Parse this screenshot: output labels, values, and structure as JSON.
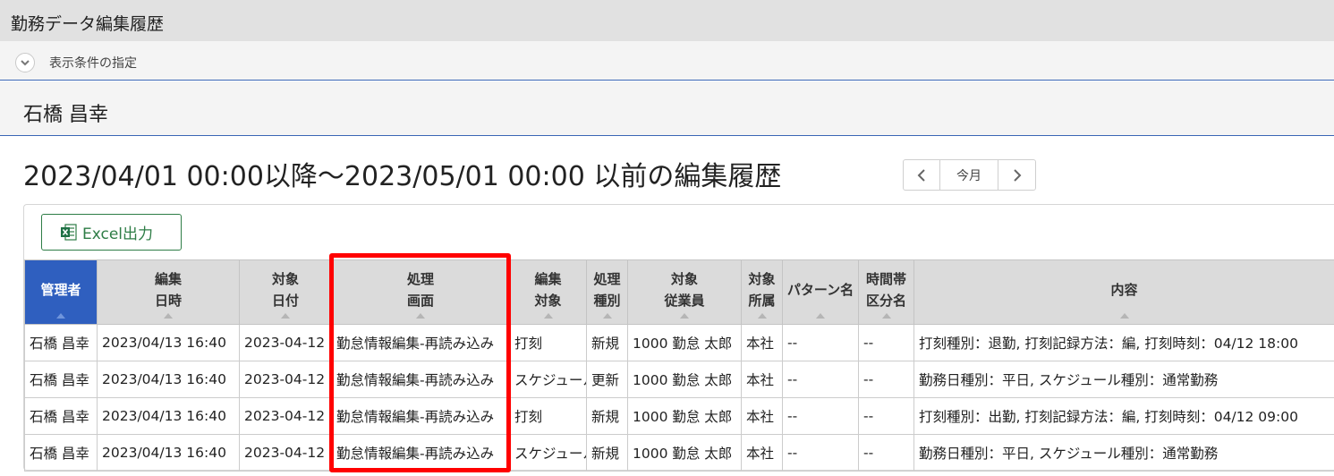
{
  "page": {
    "title": "勤務データ編集履歴",
    "condition_label": "表示条件の指定",
    "employee_name": "石橋 昌幸",
    "heading": "2023/04/01 00:00以降～2023/05/01 00:00 以前の編集履歴",
    "pager": {
      "prev": "‹",
      "current": "今月",
      "next": "›"
    },
    "excel_button": "Excel出力"
  },
  "table": {
    "headers": [
      {
        "l1": "管理者",
        "l2": ""
      },
      {
        "l1": "編集",
        "l2": "日時"
      },
      {
        "l1": "対象",
        "l2": "日付"
      },
      {
        "l1": "処理",
        "l2": "画面"
      },
      {
        "l1": "編集",
        "l2": "対象"
      },
      {
        "l1": "処理",
        "l2": "種別"
      },
      {
        "l1": "対象",
        "l2": "従業員"
      },
      {
        "l1": "対象",
        "l2": "所属"
      },
      {
        "l1": "パターン名",
        "l2": ""
      },
      {
        "l1": "時間帯",
        "l2": "区分名"
      },
      {
        "l1": "内容",
        "l2": ""
      }
    ],
    "rows": [
      [
        "石橋 昌幸",
        "2023/04/13 16:40",
        "2023-04-12",
        "勤怠情報編集-再読み込み",
        "打刻",
        "新規",
        "1000 勤怠 太郎",
        "本社",
        "--",
        "--",
        "打刻種別：退勤, 打刻記録方法：編, 打刻時刻：04/12 18:00"
      ],
      [
        "石橋 昌幸",
        "2023/04/13 16:40",
        "2023-04-12",
        "勤怠情報編集-再読み込み",
        "スケジュール",
        "更新",
        "1000 勤怠 太郎",
        "本社",
        "--",
        "--",
        "勤務日種別：平日, スケジュール種別：通常勤務"
      ],
      [
        "石橋 昌幸",
        "2023/04/13 16:40",
        "2023-04-12",
        "勤怠情報編集-再読み込み",
        "打刻",
        "新規",
        "1000 勤怠 太郎",
        "本社",
        "--",
        "--",
        "打刻種別：出勤, 打刻記録方法：編, 打刻時刻：04/12 09:00"
      ],
      [
        "石橋 昌幸",
        "2023/04/13 16:40",
        "2023-04-12",
        "勤怠情報編集-再読み込み",
        "スケジュール",
        "新規",
        "1000 勤怠 太郎",
        "本社",
        "--",
        "--",
        "勤務日種別：平日, スケジュール種別：通常勤務"
      ]
    ]
  },
  "colors": {
    "accent": "#2f5fbf",
    "excel_green": "#2e7d46",
    "highlight": "#ff0000"
  }
}
